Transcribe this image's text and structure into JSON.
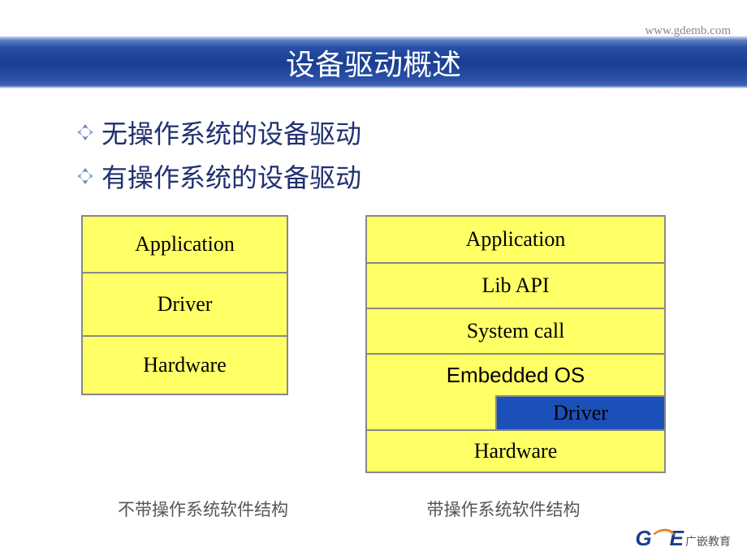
{
  "header": {
    "url": "www.gdemb.com",
    "title": "设备驱动概述"
  },
  "bullets": [
    "无操作系统的设备驱动",
    "有操作系统的设备驱动"
  ],
  "diagram_left": {
    "layers": {
      "app": "Application",
      "driver": "Driver",
      "hardware": "Hardware"
    },
    "caption": "不带操作系统软件结构"
  },
  "diagram_right": {
    "layers": {
      "app": "Application",
      "lib": "Lib API",
      "syscall": "System call",
      "os": "Embedded OS",
      "driver": "Driver",
      "hardware": "Hardware"
    },
    "caption": "带操作系统软件结构"
  },
  "logo": {
    "letters": "GE",
    "chinese": "广嵌教育"
  }
}
